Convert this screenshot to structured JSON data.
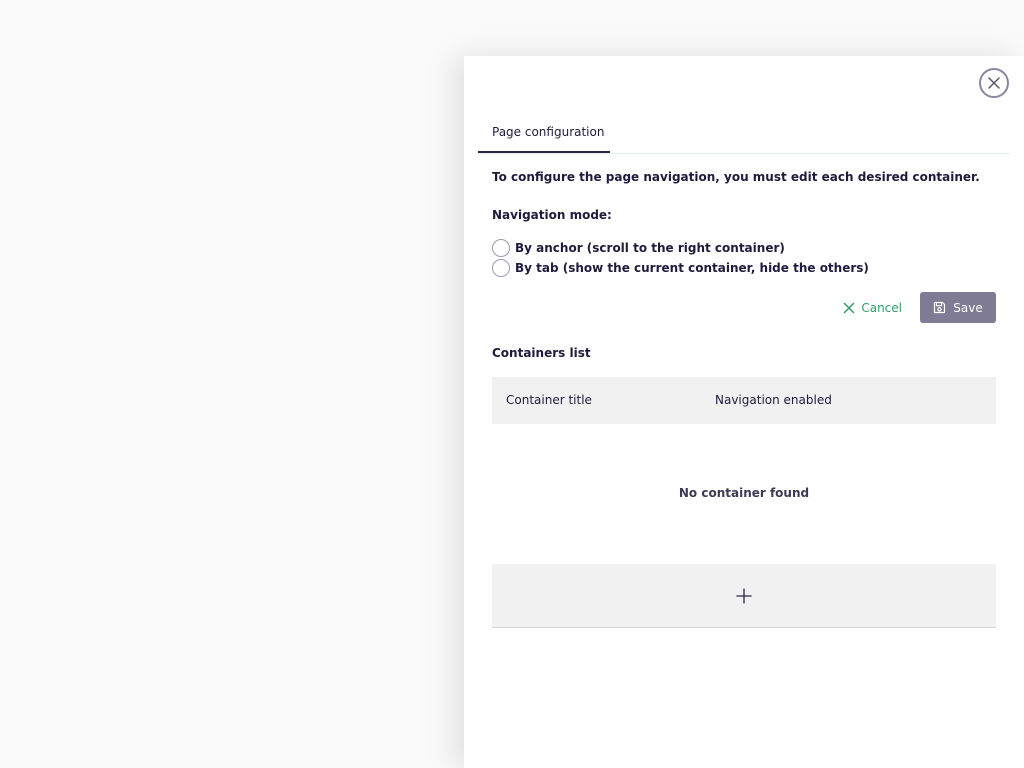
{
  "panel": {
    "close_icon": "close-icon",
    "tabs": [
      {
        "label": "Page configuration"
      }
    ],
    "intro": "To configure the page navigation, you must edit each desired container.",
    "navigation_mode": {
      "label": "Navigation mode:",
      "options": [
        {
          "label": "By anchor (scroll to the right container)",
          "selected": false
        },
        {
          "label": "By tab (show the current container, hide the others)",
          "selected": false
        }
      ]
    },
    "actions": {
      "cancel_label": "Cancel",
      "save_label": "Save",
      "cancel_icon": "x-icon",
      "save_icon": "floppy-disk-icon"
    },
    "containers": {
      "label": "Containers list",
      "columns": [
        "Container title",
        "Navigation enabled"
      ],
      "empty_message": "No container found",
      "add_icon": "plus-icon"
    }
  },
  "colors": {
    "accent_green": "#2f9e6a",
    "save_button_bg": "#7f7b94",
    "text_primary": "#1f1b3d"
  }
}
